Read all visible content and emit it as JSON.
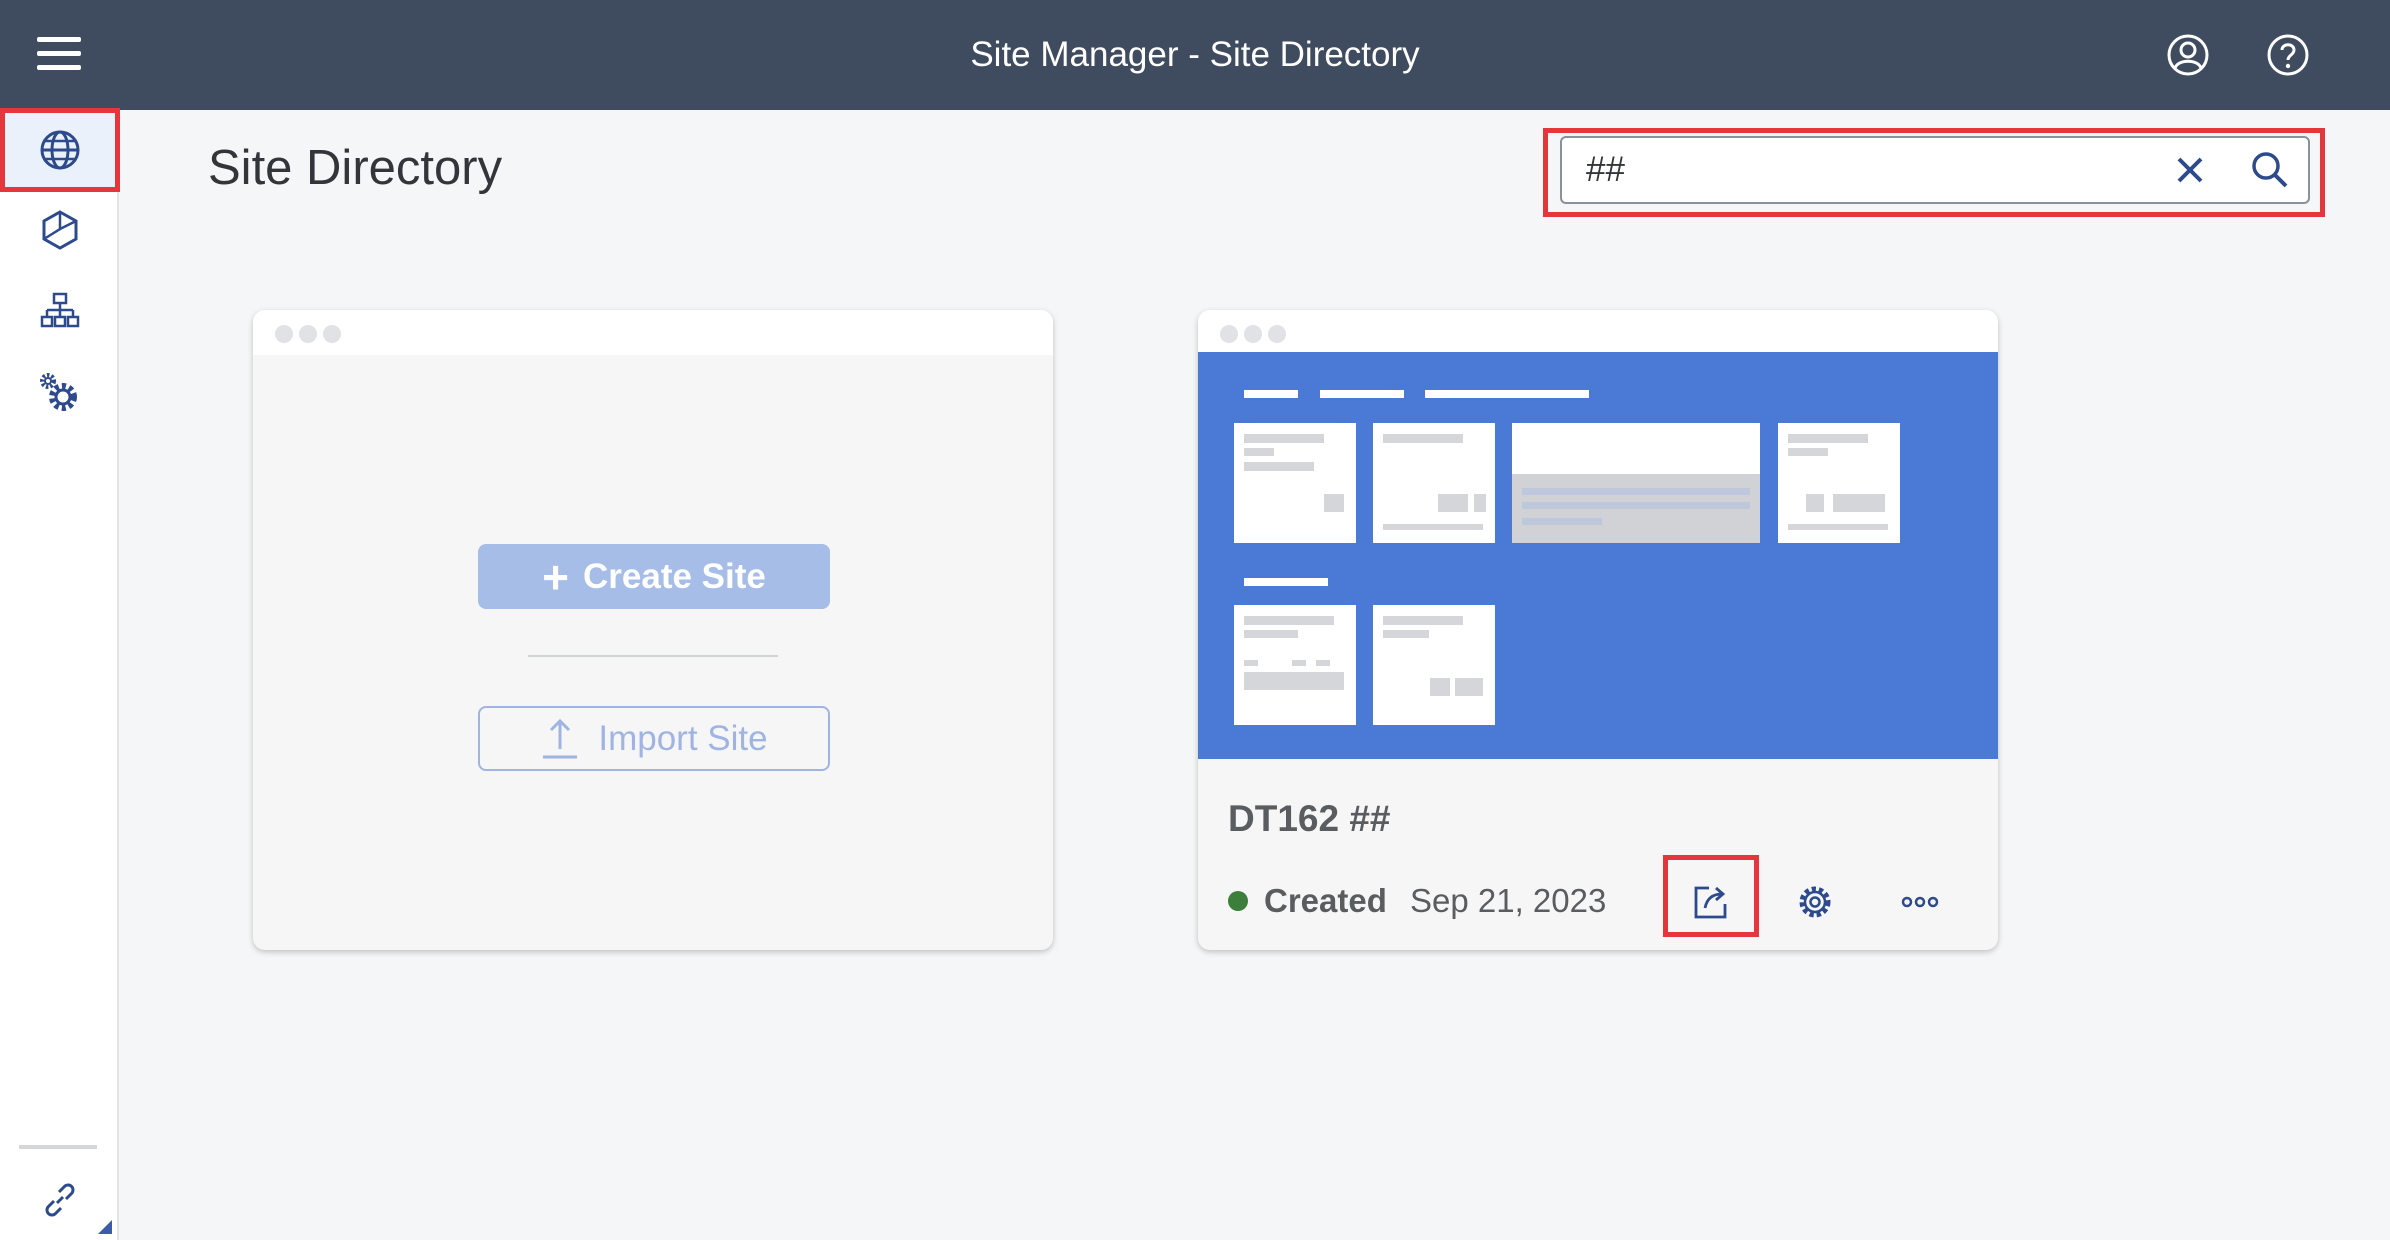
{
  "shell": {
    "title": "Site Manager - Site Directory"
  },
  "nav": {
    "items": [
      {
        "name": "site-directory",
        "icon": "globe-icon"
      },
      {
        "name": "content-manager",
        "icon": "cube-icon"
      },
      {
        "name": "provider-manager",
        "icon": "hierarchy-icon"
      },
      {
        "name": "settings",
        "icon": "gears-icon"
      }
    ],
    "bottom_icon": "link-icon"
  },
  "page": {
    "title": "Site Directory"
  },
  "search": {
    "value": "##"
  },
  "create_card": {
    "create_label": "Create Site",
    "import_label": "Import Site"
  },
  "site_card": {
    "name": "DT162 ##",
    "status": "Created",
    "date": "Sep 21, 2023",
    "status_color": "#3b7f3b",
    "preview_color": "#4a79d6"
  },
  "highlight_color": "#e5353d"
}
